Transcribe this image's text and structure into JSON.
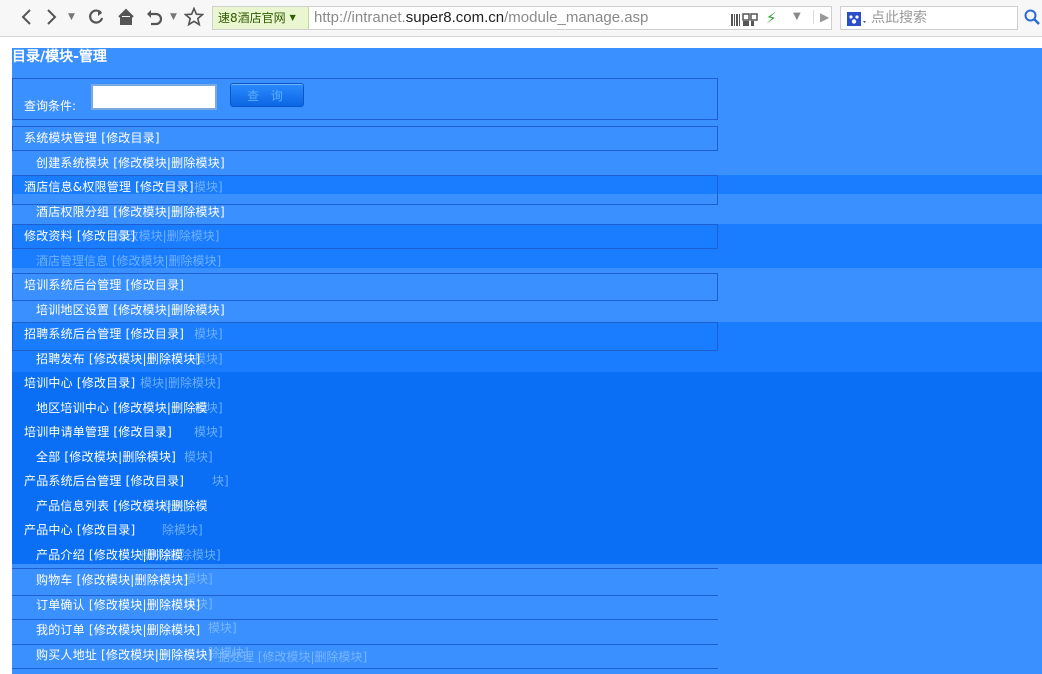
{
  "browser": {
    "site_badge": "速8酒店官网",
    "url_scheme": "http://intranet.",
    "url_host": "super8.com.cn",
    "url_path": "/module_manage.asp",
    "search_placeholder": "点此搜索"
  },
  "page": {
    "title": "目录/模块-管理",
    "query_label": "查询条件:",
    "query_value": "",
    "query_button": "查 询"
  },
  "rows": [
    {
      "text": "系统模块管理 [修改目录]",
      "level": 1
    },
    {
      "text": "创建系统模块 [修改模块|删除模块]",
      "level": 2
    },
    {
      "text": "酒店信息&权限管理 [修改目录]",
      "level": 1
    },
    {
      "text": "酒店权限分组 [修改模块|删除模块]",
      "level": 2
    },
    {
      "text": "修改资料 [修改目录]",
      "level": 1
    },
    {
      "text": "",
      "level": 2
    },
    {
      "text": "培训系统后台管理 [修改目录]",
      "level": 1
    },
    {
      "text": "培训地区设置 [修改模块|删除模块]",
      "level": 2
    },
    {
      "text": "招聘系统后台管理 [修改目录]",
      "level": 1
    },
    {
      "text": "招聘发布 [修改模块|删除模块]",
      "level": 2
    },
    {
      "text": "培训中心 [修改目录]",
      "level": 1
    },
    {
      "text": "地区培训中心 [修改模块|删除模",
      "level": 2
    },
    {
      "text": "培训申请单管理 [修改目录]",
      "level": 1
    },
    {
      "text": "全部 [修改模块|删除模块]",
      "level": 2
    },
    {
      "text": "产品系统后台管理 [修改目录]",
      "level": 1
    },
    {
      "text": "产品信息列表 [修改模块|删除模",
      "level": 2
    },
    {
      "text": "产品中心 [修改目录]",
      "level": 1
    },
    {
      "text": "产品介绍 [修改模块|删除模",
      "level": 2
    },
    {
      "text": "购物车 [修改模块|删除模块]",
      "level": 2
    },
    {
      "text": "订单确认 [修改模块|删除模块]",
      "level": 2
    },
    {
      "text": "我的订单 [修改模块|删除模块]",
      "level": 2
    },
    {
      "text": "购买人地址 [修改模块|删除模块]",
      "level": 2
    }
  ],
  "ghost_texts": [
    "模块]",
    "[修改模块|删除模块]",
    "酒店管理信息 [修改模块|删除模块]",
    "模块]",
    "模块]",
    "模块|删除模块]",
    "模块]",
    "模块]",
    "模块]",
    "块]",
    "模块]",
    "除模块]",
    "模块|删除模块]",
    "模块]",
    "模块]",
    "模块]",
    "除模块]",
    "据处理 [修改模块|删除模块]"
  ],
  "colors": {
    "page_bg": "#3a90ff",
    "band_bg": "#1a7cff",
    "link_text": "#ffffff"
  }
}
